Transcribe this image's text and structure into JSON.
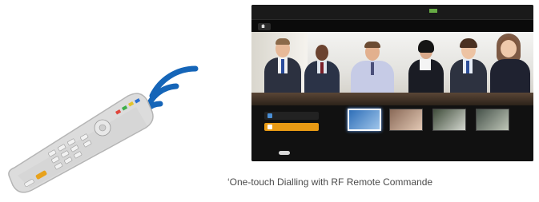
{
  "caption": "‘One-touch Dialling with RF Remote Commande",
  "remote": {
    "icons": [
      "remote-control-icon",
      "wireless-signal-icon"
    ],
    "signal_color": "#1565b8"
  },
  "tv_screen": {
    "logo": "",
    "home_label": "",
    "menu_items": [
      "",
      "",
      "",
      ""
    ],
    "side_items": [
      "",
      ""
    ],
    "thumbnails": [
      "",
      "",
      "",
      ""
    ],
    "accent_color": "#e89a14",
    "image_description_icon": "video-conference-participants"
  }
}
